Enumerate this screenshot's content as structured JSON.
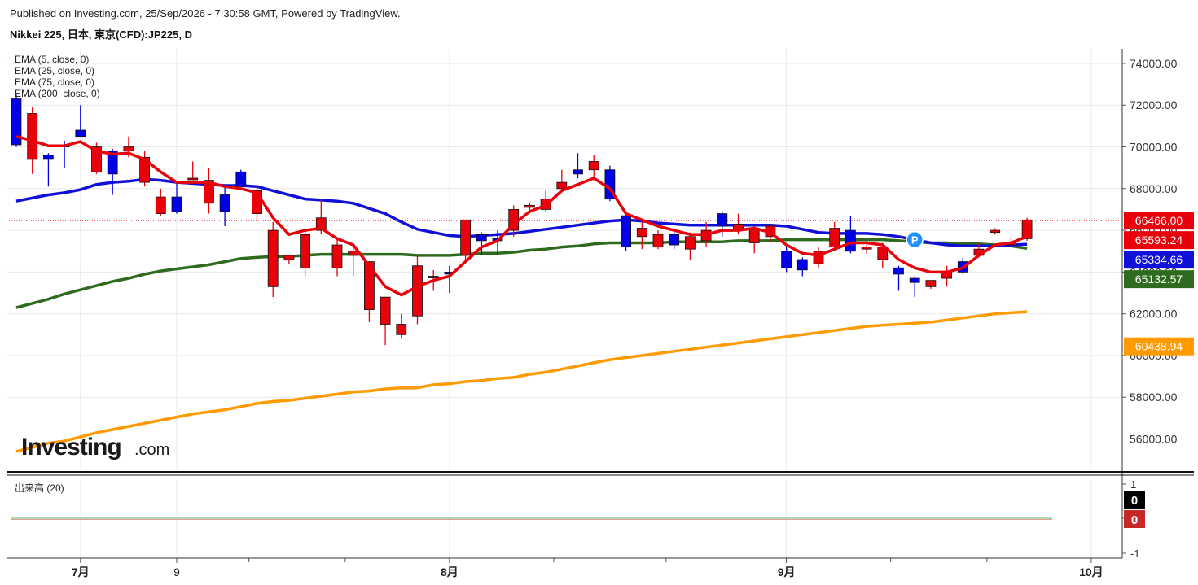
{
  "header": {
    "published": "Published on Investing.com, 25/Sep/2026 - 7:30:58 GMT, Powered by TradingView.",
    "symbol": "Nikkei 225, 日本, 東京(CFD):JP225, D"
  },
  "legend": [
    "EMA (5, close, 0)",
    "EMA (25, close, 0)",
    "EMA (75, close, 0)",
    "EMA (200, close, 0)"
  ],
  "brand": {
    "logo_main": "Investing",
    "logo_suffix": ".com"
  },
  "colors": {
    "up": "#e8000b",
    "down": "#0000e6",
    "ema5": "#e8000b",
    "ema25": "#1010d8",
    "ema75": "#2e6b1f",
    "ema200": "#ff9a00",
    "grid": "#e9e9e9"
  },
  "chart_data": {
    "type": "candlestick",
    "y_axis": {
      "min": 54500,
      "max": 74700,
      "ticks": [
        "74000.00",
        "72000.00",
        "70000.00",
        "68000.00",
        "66000.00",
        "64000.00",
        "62000.00",
        "60000.00",
        "58000.00",
        "56000.00"
      ]
    },
    "x_axis": {
      "ticks": [
        {
          "label": "7月",
          "bold": true,
          "i": 4
        },
        {
          "label": "9",
          "bold": false,
          "i": 10
        },
        {
          "label": "8月",
          "bold": true,
          "i": 27
        },
        {
          "label": "9月",
          "bold": true,
          "i": 48
        },
        {
          "label": "10月",
          "bold": true,
          "i": 67
        }
      ]
    },
    "candles": [
      {
        "o": 72300,
        "h": 72500,
        "l": 70000,
        "c": 70100
      },
      {
        "o": 69400,
        "h": 71900,
        "l": 68700,
        "c": 71600
      },
      {
        "o": 69600,
        "h": 69700,
        "l": 68100,
        "c": 69400
      },
      {
        "o": 70100,
        "h": 70300,
        "l": 69000,
        "c": 70000
      },
      {
        "o": 70800,
        "h": 72000,
        "l": 70600,
        "c": 70500
      },
      {
        "o": 68800,
        "h": 70200,
        "l": 68700,
        "c": 70000
      },
      {
        "o": 69800,
        "h": 69900,
        "l": 67700,
        "c": 68700
      },
      {
        "o": 69800,
        "h": 70500,
        "l": 69500,
        "c": 70000
      },
      {
        "o": 68300,
        "h": 69800,
        "l": 68100,
        "c": 69500
      },
      {
        "o": 66800,
        "h": 68000,
        "l": 66700,
        "c": 67600
      },
      {
        "o": 67600,
        "h": 68300,
        "l": 66800,
        "c": 66900
      },
      {
        "o": 68500,
        "h": 69300,
        "l": 68400,
        "c": 68500
      },
      {
        "o": 67300,
        "h": 69000,
        "l": 66800,
        "c": 68400
      },
      {
        "o": 67700,
        "h": 68200,
        "l": 66200,
        "c": 66900
      },
      {
        "o": 68800,
        "h": 68900,
        "l": 68200,
        "c": 68100
      },
      {
        "o": 66800,
        "h": 68100,
        "l": 66500,
        "c": 67900
      },
      {
        "o": 63300,
        "h": 66400,
        "l": 62800,
        "c": 66000
      },
      {
        "o": 64600,
        "h": 64800,
        "l": 64400,
        "c": 64800
      },
      {
        "o": 64200,
        "h": 66000,
        "l": 63800,
        "c": 65800
      },
      {
        "o": 66000,
        "h": 67500,
        "l": 65800,
        "c": 66600
      },
      {
        "o": 64200,
        "h": 65600,
        "l": 63800,
        "c": 65300
      },
      {
        "o": 64800,
        "h": 65200,
        "l": 63800,
        "c": 65000
      },
      {
        "o": 62200,
        "h": 64400,
        "l": 61600,
        "c": 64500
      },
      {
        "o": 61500,
        "h": 62800,
        "l": 60500,
        "c": 62800
      },
      {
        "o": 61000,
        "h": 62000,
        "l": 60800,
        "c": 61500
      },
      {
        "o": 61900,
        "h": 64800,
        "l": 61500,
        "c": 64300
      },
      {
        "o": 63800,
        "h": 64100,
        "l": 63100,
        "c": 63800
      },
      {
        "o": 64000,
        "h": 64300,
        "l": 63000,
        "c": 63900
      },
      {
        "o": 64800,
        "h": 66200,
        "l": 64600,
        "c": 66500
      },
      {
        "o": 65800,
        "h": 65900,
        "l": 64800,
        "c": 65500
      },
      {
        "o": 65600,
        "h": 66000,
        "l": 64800,
        "c": 65500
      },
      {
        "o": 66000,
        "h": 67200,
        "l": 65700,
        "c": 67000
      },
      {
        "o": 67100,
        "h": 67300,
        "l": 66900,
        "c": 67200
      },
      {
        "o": 67000,
        "h": 67900,
        "l": 66900,
        "c": 67500
      },
      {
        "o": 68000,
        "h": 68900,
        "l": 67900,
        "c": 68300
      },
      {
        "o": 68900,
        "h": 69700,
        "l": 68500,
        "c": 68700
      },
      {
        "o": 68900,
        "h": 69600,
        "l": 68400,
        "c": 69300
      },
      {
        "o": 68900,
        "h": 69100,
        "l": 67400,
        "c": 67500
      },
      {
        "o": 66700,
        "h": 66900,
        "l": 65000,
        "c": 65200
      },
      {
        "o": 65700,
        "h": 66400,
        "l": 65100,
        "c": 66100
      },
      {
        "o": 65200,
        "h": 66000,
        "l": 65100,
        "c": 65800
      },
      {
        "o": 65800,
        "h": 66100,
        "l": 65100,
        "c": 65300
      },
      {
        "o": 65100,
        "h": 65900,
        "l": 64600,
        "c": 65700
      },
      {
        "o": 65500,
        "h": 66400,
        "l": 65200,
        "c": 66000
      },
      {
        "o": 66800,
        "h": 66900,
        "l": 65700,
        "c": 66200
      },
      {
        "o": 66000,
        "h": 66800,
        "l": 65800,
        "c": 66300
      },
      {
        "o": 65400,
        "h": 66200,
        "l": 64900,
        "c": 66100
      },
      {
        "o": 65700,
        "h": 66300,
        "l": 65400,
        "c": 66200
      },
      {
        "o": 65000,
        "h": 65200,
        "l": 64000,
        "c": 64200
      },
      {
        "o": 64600,
        "h": 64700,
        "l": 63800,
        "c": 64100
      },
      {
        "o": 64400,
        "h": 65200,
        "l": 64200,
        "c": 65000
      },
      {
        "o": 65200,
        "h": 66400,
        "l": 65100,
        "c": 66100
      },
      {
        "o": 66000,
        "h": 66700,
        "l": 64900,
        "c": 65000
      },
      {
        "o": 65100,
        "h": 65300,
        "l": 64900,
        "c": 65200
      },
      {
        "o": 64600,
        "h": 65400,
        "l": 64200,
        "c": 65200
      },
      {
        "o": 64200,
        "h": 64300,
        "l": 63100,
        "c": 63900
      },
      {
        "o": 63700,
        "h": 63800,
        "l": 62800,
        "c": 63500
      },
      {
        "o": 63300,
        "h": 63600,
        "l": 63200,
        "c": 63600
      },
      {
        "o": 63700,
        "h": 64300,
        "l": 63300,
        "c": 64000
      },
      {
        "o": 64500,
        "h": 64700,
        "l": 63900,
        "c": 64000
      },
      {
        "o": 64800,
        "h": 65400,
        "l": 64700,
        "c": 65100
      },
      {
        "o": 65900,
        "h": 66100,
        "l": 65800,
        "c": 66000
      },
      {
        "o": 65300,
        "h": 65700,
        "l": 65200,
        "c": 65400
      },
      {
        "o": 65600,
        "h": 66600,
        "l": 65500,
        "c": 66500
      }
    ],
    "ema5": [
      70500,
      70300,
      70050,
      70050,
      70250,
      69800,
      69650,
      69700,
      69400,
      68800,
      68300,
      68300,
      68300,
      68100,
      68000,
      67800,
      66600,
      65800,
      66000,
      66100,
      65600,
      65300,
      64300,
      63300,
      62900,
      63300,
      63600,
      63800,
      64500,
      65200,
      65500,
      66300,
      66900,
      67200,
      67900,
      68200,
      68500,
      68000,
      66800,
      66500,
      66200,
      66000,
      65800,
      65800,
      66000,
      66000,
      66100,
      65900,
      65300,
      64900,
      64800,
      65100,
      65400,
      65400,
      65300,
      64600,
      64200,
      64000,
      64000,
      64200,
      64800,
      65300,
      65400,
      65700
    ],
    "ema25": [
      67400,
      67550,
      67700,
      67800,
      67950,
      68200,
      68300,
      68350,
      68450,
      68400,
      68300,
      68250,
      68200,
      68150,
      68150,
      68100,
      67900,
      67700,
      67500,
      67450,
      67400,
      67300,
      67050,
      66800,
      66400,
      66050,
      65900,
      65750,
      65700,
      65750,
      65800,
      65850,
      65950,
      66050,
      66150,
      66250,
      66350,
      66450,
      66500,
      66450,
      66350,
      66300,
      66250,
      66250,
      66250,
      66250,
      66250,
      66250,
      66200,
      66050,
      65900,
      65850,
      65850,
      65850,
      65800,
      65700,
      65550,
      65400,
      65300,
      65250,
      65250,
      65250,
      65300,
      65334.66
    ],
    "ema75": [
      62300,
      62500,
      62700,
      62950,
      63150,
      63350,
      63550,
      63700,
      63900,
      64050,
      64150,
      64250,
      64350,
      64500,
      64650,
      64700,
      64750,
      64750,
      64800,
      64850,
      64850,
      64850,
      64850,
      64850,
      64850,
      64800,
      64800,
      64800,
      64850,
      64900,
      64900,
      64950,
      65050,
      65100,
      65200,
      65250,
      65350,
      65400,
      65400,
      65400,
      65400,
      65450,
      65450,
      65450,
      65450,
      65500,
      65500,
      65500,
      65550,
      65550,
      65550,
      65550,
      65550,
      65550,
      65550,
      65500,
      65450,
      65400,
      65400,
      65350,
      65350,
      65300,
      65250,
      65132.57
    ],
    "ema200": [
      55400,
      55600,
      55800,
      55900,
      56100,
      56300,
      56450,
      56600,
      56750,
      56900,
      57050,
      57200,
      57300,
      57400,
      57550,
      57700,
      57800,
      57850,
      57950,
      58050,
      58150,
      58250,
      58300,
      58400,
      58450,
      58450,
      58600,
      58650,
      58750,
      58800,
      58900,
      58950,
      59100,
      59200,
      59350,
      59500,
      59650,
      59800,
      59900,
      60000,
      60100,
      60200,
      60300,
      60400,
      60500,
      60600,
      60700,
      60800,
      60900,
      61000,
      61100,
      61200,
      61300,
      61400,
      61450,
      61500,
      61550,
      61600,
      61700,
      61800,
      61900,
      62000,
      62050,
      62100
    ],
    "current_price_line": 66466,
    "price_tags": [
      {
        "value": 66466,
        "label": "66466.00",
        "bg": "#e8000b",
        "fg": "#ffffff"
      },
      {
        "value": 65593.24,
        "label": "65593.24",
        "bg": "#e8000b",
        "fg": "#ffffff"
      },
      {
        "value": 65334.66,
        "label": "65334.66",
        "bg": "#1010d8",
        "fg": "#ffffff"
      },
      {
        "value": 65132.57,
        "label": "65132.57",
        "bg": "#2e6b1f",
        "fg": "#ffffff"
      },
      {
        "value": 60438.94,
        "label": "60438.94",
        "bg": "#ff9a00",
        "fg": "#ffffff"
      }
    ],
    "marker": {
      "label": "P",
      "i": 56,
      "value": 65550
    },
    "volume": {
      "label": "出来高 (20)",
      "ticks": [
        "1",
        "0",
        "-1"
      ],
      "tags": [
        {
          "label": "0",
          "bg": "#000000",
          "fg": "#ffffff"
        },
        {
          "label": "0",
          "bg": "#c62828",
          "fg": "#ffffff"
        }
      ]
    }
  }
}
